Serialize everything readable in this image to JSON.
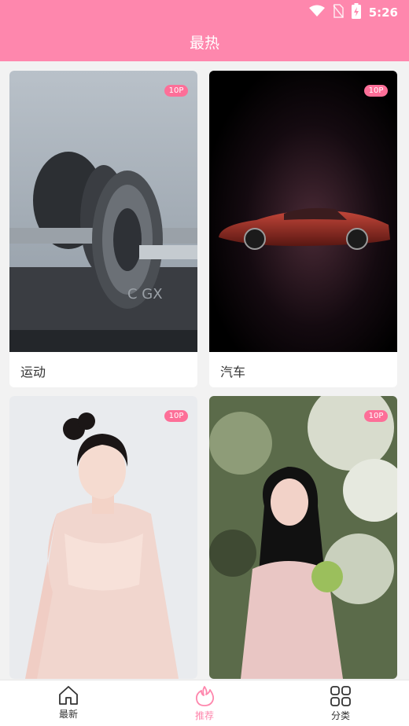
{
  "status_bar": {
    "time": "5:26",
    "icons": [
      "wifi-icon",
      "no-sim-icon",
      "battery-charging-icon"
    ]
  },
  "header": {
    "title": "最热"
  },
  "cards": [
    {
      "label": "运动",
      "badge": "10P"
    },
    {
      "label": "汽车",
      "badge": "10P"
    },
    {
      "label": "",
      "badge": "10P"
    },
    {
      "label": "",
      "badge": "10P"
    }
  ],
  "tabbar": {
    "tabs": [
      {
        "label": "最新",
        "icon": "home-icon"
      },
      {
        "label": "推荐",
        "icon": "flame-icon",
        "active": true
      },
      {
        "label": "分类",
        "icon": "grid-icon"
      }
    ]
  },
  "colors": {
    "accent": "#fe87ad",
    "badge": "#fd6f98"
  }
}
